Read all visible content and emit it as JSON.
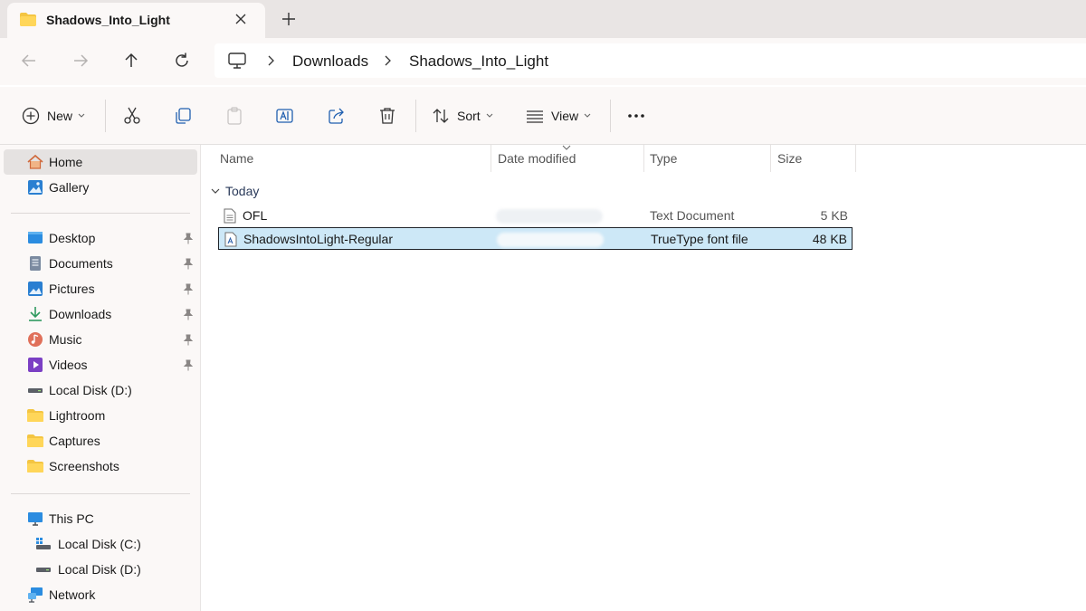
{
  "tab": {
    "title": "Shadows_Into_Light"
  },
  "breadcrumb": {
    "items": [
      "Downloads",
      "Shadows_Into_Light"
    ]
  },
  "toolbar": {
    "new_label": "New",
    "sort_label": "Sort",
    "view_label": "View",
    "icons": [
      "plus-circle",
      "cut",
      "copy",
      "paste",
      "rename",
      "share",
      "delete",
      "sort",
      "view",
      "more"
    ]
  },
  "sidebar": {
    "home": "Home",
    "gallery": "Gallery",
    "quick_access": [
      {
        "label": "Desktop",
        "icon": "desktop-icon"
      },
      {
        "label": "Documents",
        "icon": "documents-icon"
      },
      {
        "label": "Pictures",
        "icon": "pictures-icon"
      },
      {
        "label": "Downloads",
        "icon": "download-icon"
      },
      {
        "label": "Music",
        "icon": "music-icon"
      },
      {
        "label": "Videos",
        "icon": "videos-icon"
      },
      {
        "label": "Local Disk (D:)",
        "icon": "drive-icon"
      },
      {
        "label": "Lightroom",
        "icon": "folder-icon"
      },
      {
        "label": "Captures",
        "icon": "folder-icon"
      },
      {
        "label": "Screenshots",
        "icon": "folder-icon"
      }
    ],
    "this_pc": "This PC",
    "drives": [
      "Local Disk (C:)",
      "Local Disk (D:)"
    ],
    "network": "Network"
  },
  "columns": {
    "name": "Name",
    "date": "Date modified",
    "type": "Type",
    "size": "Size"
  },
  "group": {
    "label": "Today"
  },
  "files": [
    {
      "name": "OFL",
      "type": "Text Document",
      "size": "5 KB",
      "selected": false
    },
    {
      "name": "ShadowsIntoLight-Regular",
      "type": "TrueType font file",
      "size": "48 KB",
      "selected": true
    }
  ],
  "colors": {
    "selection": "#cde8f7",
    "folder": "#f4c542",
    "accent": "#0067c0"
  }
}
